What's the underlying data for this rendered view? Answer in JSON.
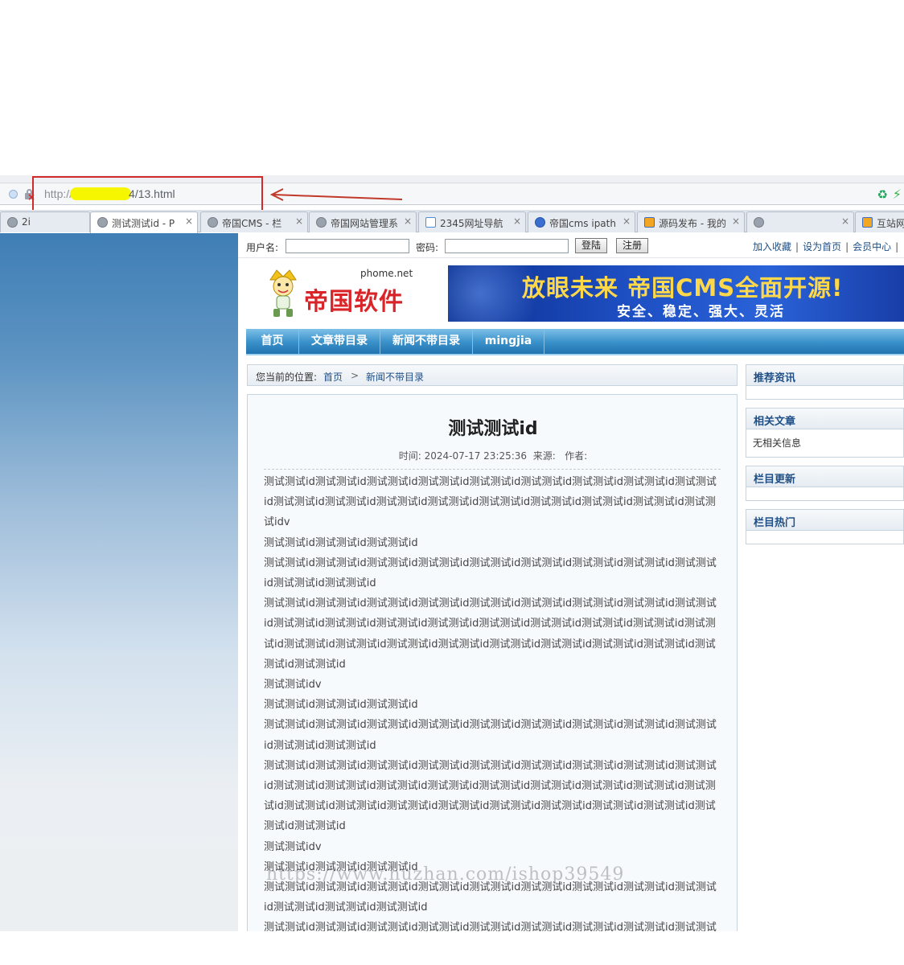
{
  "browser": {
    "url_prefix": "http://",
    "url_suffix": "4/13.html",
    "tabs": [
      {
        "label": "2i",
        "icon": "plain-tab-icon"
      },
      {
        "label": "测试测试id - P",
        "icon": "globe-icon",
        "active": true
      },
      {
        "label": "帝国CMS - 栏",
        "icon": "globe-icon"
      },
      {
        "label": "帝国网站管理系",
        "icon": "globe-icon"
      },
      {
        "label": "2345网址导航",
        "icon": "2345-icon"
      },
      {
        "label": "帝国cms ipath",
        "icon": "baidu-paw-icon"
      },
      {
        "label": "源码发布 - 我的",
        "icon": "code-icon"
      },
      {
        "label": "",
        "icon": "globe-icon"
      },
      {
        "label": "互站网",
        "icon": "code-icon"
      }
    ]
  },
  "login": {
    "username_label": "用户名:",
    "password_label": "密码:",
    "login_button": "登陆",
    "register_button": "注册",
    "links": [
      "加入收藏",
      "设为首页",
      "会员中心"
    ]
  },
  "header": {
    "logo_domain": "phome.net",
    "logo_brand": "帝国软件",
    "banner_headline": "放眼未来 帝国CMS全面开源!",
    "banner_tagline": "安全、稳定、强大、灵活"
  },
  "nav": [
    "首页",
    "文章带目录",
    "新闻不带目录",
    "mingjia"
  ],
  "breadcrumb": {
    "label": "您当前的位置:",
    "home": "首页",
    "separator": ">",
    "current": "新闻不带目录"
  },
  "article": {
    "title": "测试测试id",
    "meta": "时间: 2024-07-17 23:25:36  来源:   作者:",
    "paragraphs": [
      "测试测试id测试测试id测试测试id测试测试id测试测试id测试测试id测试测试id测试测试id测试测试id测试测试id测试测试id测试测试id测试测试id测试测试id测试测试id测试测试id测试测试id测试测试idv",
      "测试测试id测试测试id测试测试id",
      "测试测试id测试测试id测试测试id测试测试id测试测试id测试测试id测试测试id测试测试id测试测试id测试测试id测试测试id",
      "测试测试id测试测试id测试测试id测试测试id测试测试id测试测试id测试测试id测试测试id测试测试id测试测试id测试测试id测试测试id测试测试id测试测试id测试测试id测试测试id测试测试id测试测试id测试测试id测试测试id测试测试id测试测试id测试测试id测试测试id测试测试id测试测试id测试测试id测试测试id",
      "测试测试idv",
      "测试测试id测试测试id测试测试id",
      "测试测试id测试测试id测试测试id测试测试id测试测试id测试测试id测试测试id测试测试id测试测试id测试测试id测试测试id",
      "测试测试id测试测试id测试测试id测试测试id测试测试id测试测试id测试测试id测试测试id测试测试id测试测试id测试测试id测试测试id测试测试id测试测试id测试测试id测试测试id测试测试id测试测试id测试测试id测试测试id测试测试id测试测试id测试测试id测试测试id测试测试id测试测试id测试测试id测试测试id",
      "测试测试idv",
      "测试测试id测试测试id测试测试id",
      "测试测试id测试测试id测试测试id测试测试id测试测试id测试测试id测试测试id测试测试id测试测试id测试测试id测试测试id测试测试id",
      "测试测试id测试测试id测试测试id测试测试id测试测试id测试测试id测试测试id测试测试id测试测试id"
    ]
  },
  "sidebar": [
    {
      "title": "推荐资讯",
      "content": ""
    },
    {
      "title": "相关文章",
      "content": "无相关信息"
    },
    {
      "title": "栏目更新",
      "content": ""
    },
    {
      "title": "栏目热门",
      "content": ""
    }
  ],
  "watermark": "https://www.huzhan.com/ishop39549",
  "colors": {
    "annotation": "#d12a2a",
    "nav_blue": "#1f73b0",
    "link": "#1f4f86",
    "brand_red": "#d9252a"
  }
}
